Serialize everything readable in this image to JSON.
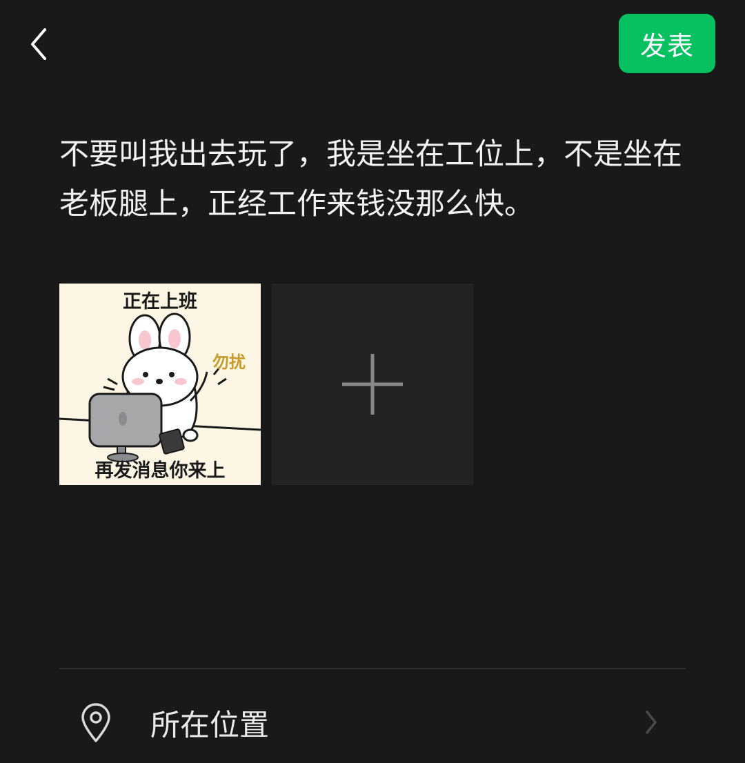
{
  "header": {
    "back_icon": "chevron-left-icon",
    "publish_label": "发表",
    "publish_color": "#07c160"
  },
  "post": {
    "text": "不要叫我出去玩了，我是坐在工位上，不是坐在老板腿上，正经工作来钱没那么快。"
  },
  "images": {
    "thumbnail": {
      "top_caption": "正在上班",
      "side_caption": "勿扰",
      "bottom_caption": "再发消息你来上"
    },
    "add_icon": "plus-icon"
  },
  "location": {
    "icon": "location-pin-icon",
    "label": "所在位置",
    "chevron_icon": "chevron-right-icon"
  }
}
